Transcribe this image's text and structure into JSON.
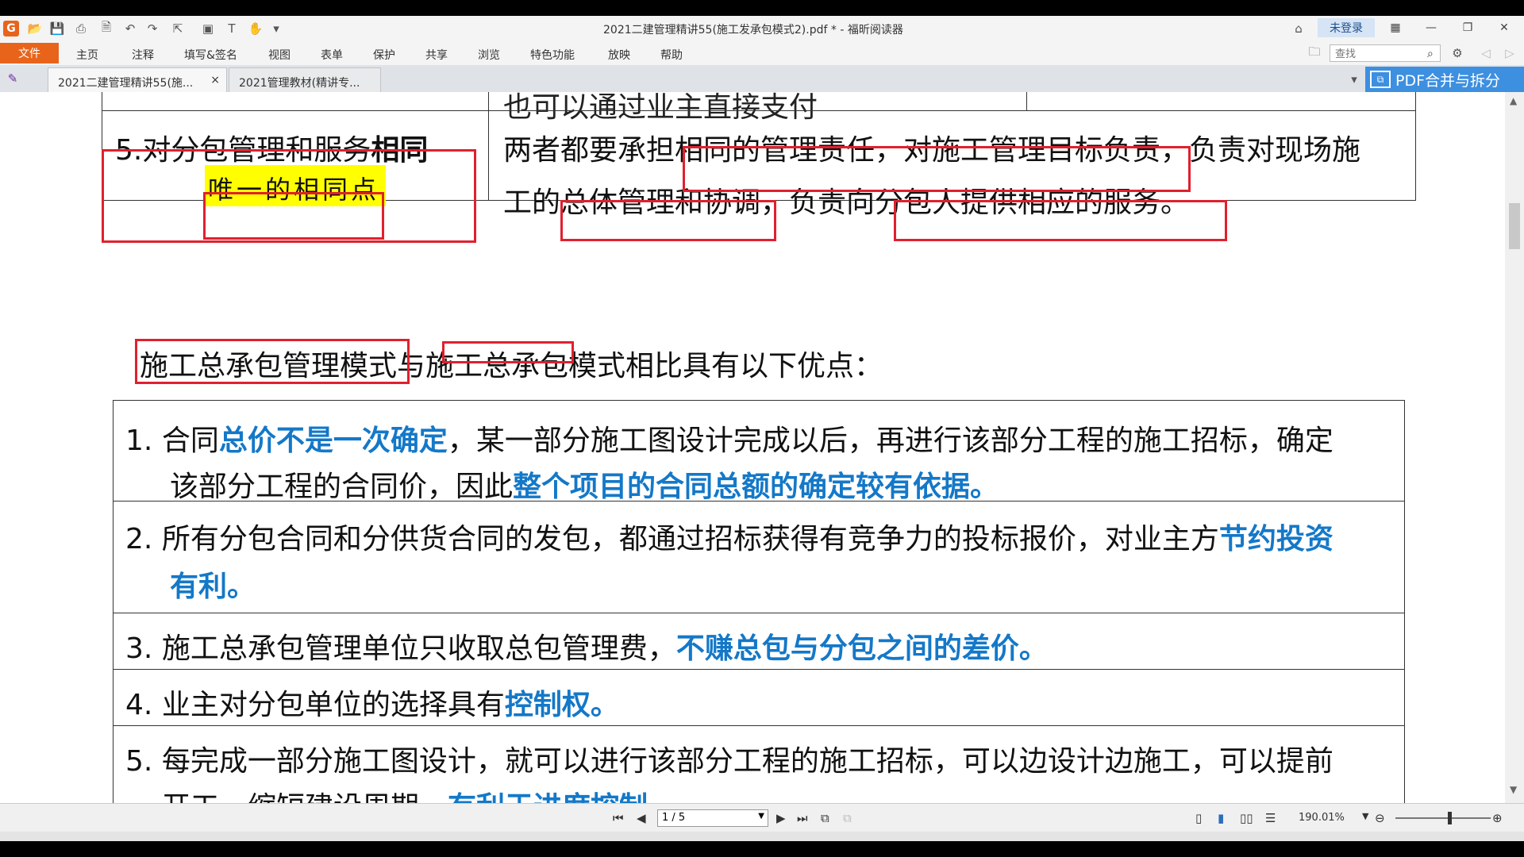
{
  "app": {
    "title": "2021二建管理精讲55(施工发承包模式2).pdf * - 福昕阅读器",
    "login_label": "未登录",
    "logo_letter": "G"
  },
  "menu": {
    "items": [
      "文件",
      "主页",
      "注释",
      "填写&签名",
      "视图",
      "表单",
      "保护",
      "共享",
      "浏览",
      "特色功能",
      "放映",
      "帮助"
    ]
  },
  "search": {
    "placeholder": "查找"
  },
  "tabs": [
    {
      "label": "2021二建管理精讲55(施...",
      "close": "×"
    },
    {
      "label": "2021管理教材(精讲专..."
    }
  ],
  "pdf_merge_label": "PDF合并与拆分",
  "doc": {
    "top_partial_text": "也可以通过业主直接支付",
    "row5": {
      "left_prefix": "5.对分包管理和服务",
      "left_bold": "相同",
      "left_note": "唯一的相同点",
      "right_line1_a": "两者都要承担",
      "right_line1_b": "相同的管理责任，对施工管理目标负责",
      "right_line1_c": "，负责对现场施",
      "right_line2_a": "工的",
      "right_line2_b": "总体管理和协调",
      "right_line2_c": "，负责向",
      "right_line2_d": "分包人提供相应的服务。"
    },
    "heading": {
      "part_a": "施工总承包管理模式",
      "part_b": "与施工总承包模式相比具有以下优点："
    },
    "items": [
      {
        "num": "1.",
        "l1a": "合同",
        "l1b": "总价不是一次确定",
        "l1c": "，某一部分施工图设计完成以后，再进行该部分工程的施工招标，确定",
        "l2a": "该部分工程的合同价，因此",
        "l2b": "整个项目的合同总额的确定较有依据。"
      },
      {
        "num": "2.",
        "l1a": "所有分包合同和分供货合同的发包，都通过招标获得有竞争力的投标报价，对业主方",
        "l1b": "节约投资",
        "l2b": "有利。"
      },
      {
        "num": "3.",
        "l1a": "施工总承包管理单位只收取总包管理费，",
        "l1b": "不赚总包与分包之间的差价。"
      },
      {
        "num": "4.",
        "l1a": "业主对分包单位的选择具有",
        "l1b": "控制权。"
      },
      {
        "num": "5.",
        "l1a": "每完成一部分施工图设计，就可以进行该部分工程的施工招标，可以边设计边施工，可以提前",
        "l2a": "开工，缩短建设周期，",
        "l2b": "有利于进度控制。"
      }
    ]
  },
  "status": {
    "page_label": "1 / 5",
    "zoom_label": "190.01%"
  }
}
